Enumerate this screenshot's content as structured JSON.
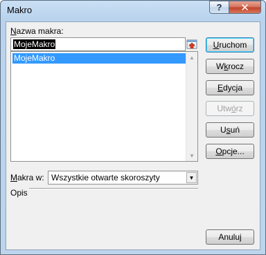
{
  "window": {
    "title": "Makro",
    "help_label": "?",
    "close_label": "✕"
  },
  "name_field": {
    "label_prefix": "N",
    "label_rest": "azwa makra:",
    "value": "MojeMakro"
  },
  "macro_list": {
    "items": [
      "MojeMakro"
    ]
  },
  "buttons": {
    "run": {
      "pre": "",
      "u": "U",
      "post": "ruchom"
    },
    "step_into": {
      "pre": "W",
      "u": "k",
      "post": "rocz"
    },
    "edit": {
      "pre": "",
      "u": "E",
      "post": "dycja"
    },
    "create": {
      "pre": "Utw",
      "u": "ó",
      "post": "rz"
    },
    "delete": {
      "pre": "U",
      "u": "s",
      "post": "uń"
    },
    "options": {
      "pre": "",
      "u": "O",
      "post": "pcje..."
    },
    "cancel": {
      "pre": "Anuluj",
      "u": "",
      "post": ""
    }
  },
  "macros_in": {
    "label_prefix": "M",
    "label_rest": "akra w:",
    "value": "Wszystkie otwarte skoroszyty"
  },
  "description": {
    "label": "Opis"
  }
}
